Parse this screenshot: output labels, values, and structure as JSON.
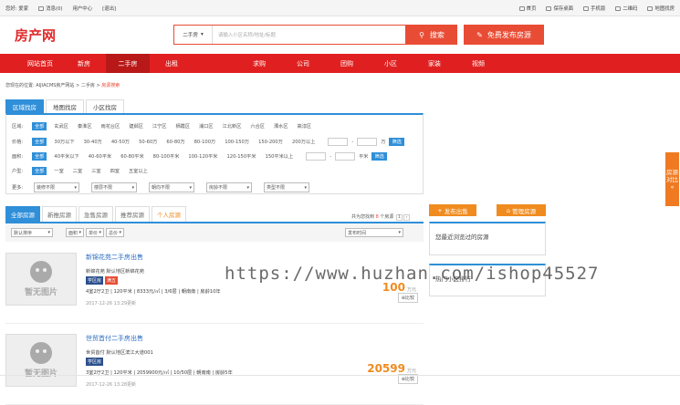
{
  "topbar": {
    "greeting": "您好: 爱家",
    "messages": "消息(0)",
    "user_center": "用户中心",
    "logout": "[退出]",
    "home": "首页",
    "save_desktop": "保存桌面",
    "mobile": "手机版",
    "qrcode": "二维码",
    "map_search": "地图找房"
  },
  "header": {
    "logo": "房产网",
    "search_type": "二手房",
    "search_placeholder": "请输入小区名称/地址/标题",
    "search_button": "搜索",
    "publish_button": "免费发布房源"
  },
  "nav": [
    "网站首页",
    "新房",
    "二手房",
    "出租",
    "",
    "求购",
    "公司",
    "团购",
    "小区",
    "家装",
    "视频"
  ],
  "breadcrumb": {
    "prefix": "您现在的位置:",
    "site": "AIJIACMS房产网站",
    "sep1": ">",
    "section": "二手房",
    "sep2": ">",
    "current": "房源搜索"
  },
  "search_tabs": [
    "区域找房",
    "地图找房",
    "小区找房"
  ],
  "filters": {
    "all": "全部",
    "area": {
      "label": "区域:",
      "options": [
        "玄武区",
        "秦淮区",
        "雨花台区",
        "建邺区",
        "江宁区",
        "栖霞区",
        "浦口区",
        "江北新区",
        "六合区",
        "溧水区",
        "高淳区"
      ]
    },
    "price": {
      "label": "价格:",
      "options": [
        "30万以下",
        "30-40万",
        "40-50万",
        "50-60万",
        "60-80万",
        "80-100万",
        "100-150万",
        "150-200万",
        "200万以上"
      ],
      "unit": "万",
      "go": "筛选",
      "dash": "-"
    },
    "size": {
      "label": "面积:",
      "options": [
        "40平米以下",
        "40-60平米",
        "60-80平米",
        "80-100平米",
        "100-120平米",
        "120-150平米",
        "150平米以上"
      ],
      "unit": "平米",
      "go": "筛选",
      "dash": "-"
    },
    "layout": {
      "label": "户型:",
      "options": [
        "一室",
        "二室",
        "三室",
        "四室",
        "五室以上"
      ]
    },
    "more": {
      "label": "更多:",
      "dropdowns": [
        "装修不限",
        "楼层不限",
        "朝向不限",
        "房龄不限",
        "类型不限"
      ]
    }
  },
  "list_tabs": [
    "全部房源",
    "新推房源",
    "急售房源",
    "推荐房源",
    "个人房源"
  ],
  "count": {
    "prefix": "共为您找到",
    "num": "8",
    "suffix": "个房源",
    "page": "1",
    "next": "›"
  },
  "sort": {
    "default": "默认排序",
    "area": "面积",
    "price": "单价",
    "total": "总价",
    "time": "发布时间"
  },
  "listings": [
    {
      "title": "新锦花苑二手房出售",
      "addr": "新锦花苑 默认地区新锦花苑",
      "tags": [
        "学区房",
        "满五"
      ],
      "details": "4室2厅2卫 | 120平米 | 8333元/㎡ | 3/6层 | 朝南南 | 房龄10年",
      "date": "2017-12-26 13:29更新",
      "price": "100",
      "unit": "万元",
      "compare": "比较",
      "noimg": "暂无图片"
    },
    {
      "title": "世贸首付二手房出售",
      "addr": "世贸首付 默认地区滨江大道001",
      "tags": [
        "学区房"
      ],
      "details": "3室2厅2卫 | 120平米 | 2059900元/㎡ | 10/50层 | 朝南南 | 房龄5年",
      "date": "2017-12-26 13:28更新",
      "price": "20599",
      "unit": "万元",
      "compare": "比较",
      "noimg": "暂无图片"
    }
  ],
  "sidebar": {
    "publish": "发布出售",
    "manage": "管理房源",
    "recent": "您最近浏览过的房源",
    "ranking": "热门小区排行"
  },
  "side_float": "房源对比",
  "watermark": "https://www.huzhan.com/ishop45527"
}
